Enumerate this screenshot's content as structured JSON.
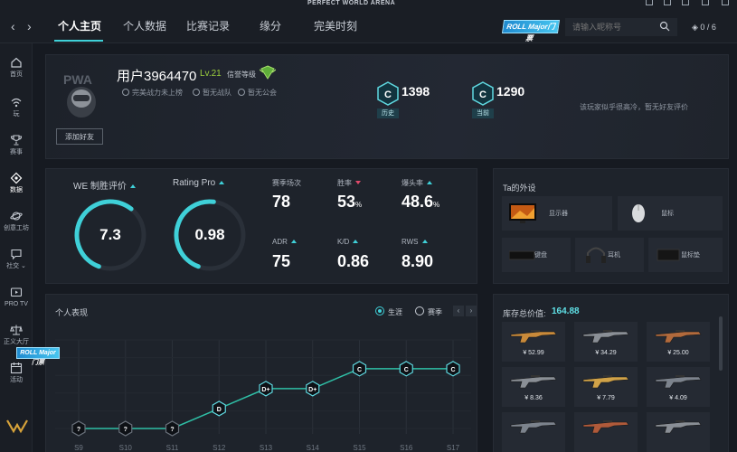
{
  "window": {
    "brand": "PERFECT WORLD ARENA"
  },
  "nav": {
    "back": "‹",
    "forward": "›",
    "tabs": [
      {
        "label": "个人主页",
        "active": true
      },
      {
        "label": "个人数据",
        "active": false
      },
      {
        "label": "比赛记录",
        "active": false
      },
      {
        "label": "缘分",
        "active": false
      },
      {
        "label": "完美时刻",
        "active": false
      }
    ],
    "roll_badge": "ROLL Major门票",
    "search_placeholder": "请输入昵称号",
    "counter": "0 / 6"
  },
  "sidebar": {
    "items": [
      {
        "label": "首页",
        "icon": "home-icon"
      },
      {
        "label": "玩",
        "icon": "wifi-icon"
      },
      {
        "label": "赛事",
        "icon": "trophy-icon"
      },
      {
        "label": "数据",
        "icon": "data-icon",
        "active": true
      },
      {
        "label": "创意工坊",
        "icon": "planet-icon"
      },
      {
        "label": "社交",
        "icon": "chat-icon"
      },
      {
        "label": "PRO TV",
        "icon": "tv-icon"
      },
      {
        "label": "正义大厅",
        "icon": "scale-icon"
      },
      {
        "label": "活动",
        "icon": "calendar-icon"
      }
    ],
    "roll_badge": "ROLL Major门票"
  },
  "profile": {
    "username": "用户3964470",
    "level": "Lv.21",
    "credit_label": "信誉等级",
    "tags": [
      "完美战力未上榜",
      "暂无战队",
      "暂无公会"
    ],
    "add_friend": "添加好友",
    "ranks": [
      {
        "value": "1398",
        "label": "历史"
      },
      {
        "value": "1290",
        "label": "当前"
      }
    ],
    "friend_note": "该玩家似乎很高冷，暂无好友评价"
  },
  "stats": {
    "gauges": [
      {
        "title": "WE 制胜评价",
        "value": "7.3",
        "fill": 0.62
      },
      {
        "title": "Rating Pro",
        "value": "0.98",
        "fill": 0.52
      }
    ],
    "cells": [
      {
        "label": "赛季场次",
        "value": "78",
        "unit": "",
        "trend": "none"
      },
      {
        "label": "胜率",
        "value": "53",
        "unit": "%",
        "trend": "down"
      },
      {
        "label": "爆头率",
        "value": "48.6",
        "unit": "%",
        "trend": "up"
      },
      {
        "label": "ADR",
        "value": "75",
        "unit": "",
        "trend": "up"
      },
      {
        "label": "K/D",
        "value": "0.86",
        "unit": "",
        "trend": "up"
      },
      {
        "label": "RWS",
        "value": "8.90",
        "unit": "",
        "trend": "up"
      }
    ]
  },
  "gear": {
    "title": "Ta的外设",
    "items": [
      {
        "name": "显示器",
        "icon": "monitor-icon"
      },
      {
        "name": "鼠标",
        "icon": "mouse-icon"
      },
      {
        "name": "键盘",
        "icon": "keyboard-icon"
      },
      {
        "name": "耳机",
        "icon": "headset-icon"
      },
      {
        "name": "鼠标垫",
        "icon": "mousepad-icon"
      }
    ]
  },
  "performance": {
    "title": "个人表现",
    "options": [
      {
        "label": "生涯",
        "selected": true
      },
      {
        "label": "赛季",
        "selected": false
      }
    ],
    "prev": "‹",
    "next": "›"
  },
  "chart_data": {
    "type": "line",
    "title": "个人表现",
    "categories": [
      "S9",
      "S10",
      "S11",
      "S12",
      "S13",
      "S14",
      "S15",
      "S16",
      "S17"
    ],
    "series": [
      {
        "values": [
          0,
          0,
          0,
          1,
          2,
          2,
          3,
          3,
          3
        ]
      }
    ],
    "point_labels": [
      "?",
      "?",
      "?",
      "D",
      "D+",
      "D+",
      "C",
      "C",
      "C"
    ],
    "ylim": [
      0,
      4
    ],
    "grid": true
  },
  "inventory": {
    "title": "库存总价值:",
    "total": "164.88",
    "items": [
      {
        "price": "¥ 52.99",
        "color": "#c98a3a"
      },
      {
        "price": "¥ 34.29",
        "color": "#8a8f96"
      },
      {
        "price": "¥ 25.00",
        "color": "#b26a3c"
      },
      {
        "price": "¥ 8.36",
        "color": "#8a8f96"
      },
      {
        "price": "¥ 7.79",
        "color": "#d0a248"
      },
      {
        "price": "¥ 4.09",
        "color": "#7c838d"
      },
      {
        "price": "",
        "color": "#7c838d"
      },
      {
        "price": "",
        "color": "#b05a3a"
      },
      {
        "price": "",
        "color": "#8a8f96"
      }
    ]
  },
  "colors": {
    "accent": "#3fd0d8",
    "background": "#161a21",
    "panel": "#1e232b"
  }
}
